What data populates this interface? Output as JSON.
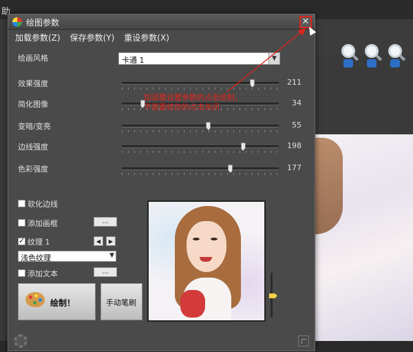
{
  "background": {
    "menu_char": "助"
  },
  "dialog": {
    "title": "绘图参数",
    "close_glyph": "✕",
    "menu": [
      "加载参数(Z)",
      "保存参数(Y)",
      "重设参数(X)"
    ],
    "style": {
      "label": "绘画风格",
      "value": "卡通 1"
    },
    "sliders": [
      {
        "label": "效果强度",
        "value": "211",
        "fraction": 0.83
      },
      {
        "label": "简化图像",
        "value": "34",
        "fraction": 0.13
      },
      {
        "label": "变暗/变亮",
        "value": "55",
        "fraction": 0.55
      },
      {
        "label": "边线强度",
        "value": "198",
        "fraction": 0.77
      },
      {
        "label": "色彩强度",
        "value": "177",
        "fraction": 0.69
      }
    ],
    "annotation": [
      "如调整设置参数的点击绘制，",
      "不需要修改的点击关闭"
    ],
    "options": {
      "soft_edge": {
        "label": "软化边线",
        "checked": false
      },
      "add_frame": {
        "label": "添加画框",
        "checked": false,
        "button": "..."
      },
      "texture": {
        "label": "纹理 1",
        "checked": true,
        "prev": "◀",
        "next": "▶"
      },
      "texture_select": "浅色纹理",
      "add_text": {
        "label": "添加文本",
        "checked": false,
        "button": "..."
      }
    },
    "buttons": {
      "draw": "绘制！",
      "manual_brush": "手动笔刷"
    }
  }
}
